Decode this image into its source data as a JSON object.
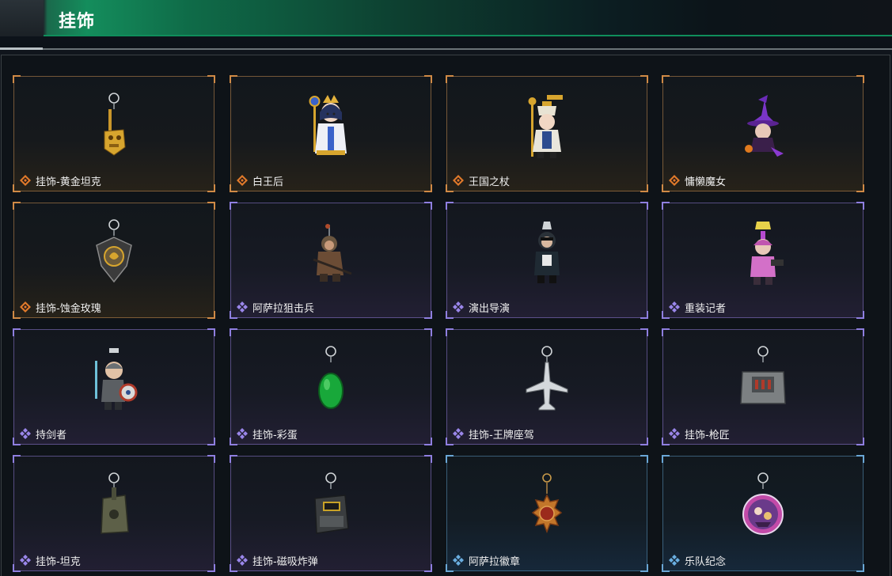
{
  "header": {
    "title": "挂饰"
  },
  "colors": {
    "gold": "#d08a46",
    "purple": "#8f7fe0",
    "blue": "#6aa7d6",
    "accent": "#148d5c"
  },
  "items": [
    {
      "label": "挂饰-黄金坦克",
      "rarity": "gold",
      "icon": "golden-tank-charm-icon"
    },
    {
      "label": "白王后",
      "rarity": "gold",
      "icon": "white-queen-charm-icon"
    },
    {
      "label": "王国之杖",
      "rarity": "gold",
      "icon": "kingdom-scepter-charm-icon"
    },
    {
      "label": "慵懒魔女",
      "rarity": "gold",
      "icon": "lazy-witch-charm-icon"
    },
    {
      "label": "挂饰-蚀金玫瑰",
      "rarity": "gold",
      "icon": "gold-rose-charm-icon"
    },
    {
      "label": "阿萨拉狙击兵",
      "rarity": "purple",
      "icon": "sniper-charm-icon"
    },
    {
      "label": "演出导演",
      "rarity": "purple",
      "icon": "show-director-charm-icon"
    },
    {
      "label": "重装记者",
      "rarity": "purple",
      "icon": "heavy-reporter-charm-icon"
    },
    {
      "label": "持剑者",
      "rarity": "purple",
      "icon": "swordsman-charm-icon"
    },
    {
      "label": "挂饰-彩蛋",
      "rarity": "purple",
      "icon": "easter-egg-charm-icon"
    },
    {
      "label": "挂饰-王牌座驾",
      "rarity": "purple",
      "icon": "ace-jet-charm-icon"
    },
    {
      "label": "挂饰-枪匠",
      "rarity": "purple",
      "icon": "gunsmith-charm-icon"
    },
    {
      "label": "挂饰-坦克",
      "rarity": "purple",
      "icon": "tank-charm-icon"
    },
    {
      "label": "挂饰-磁吸炸弹",
      "rarity": "purple",
      "icon": "magnetic-bomb-charm-icon"
    },
    {
      "label": "阿萨拉徽章",
      "rarity": "blue",
      "icon": "asala-badge-charm-icon"
    },
    {
      "label": "乐队纪念",
      "rarity": "blue",
      "icon": "band-memento-charm-icon"
    }
  ]
}
